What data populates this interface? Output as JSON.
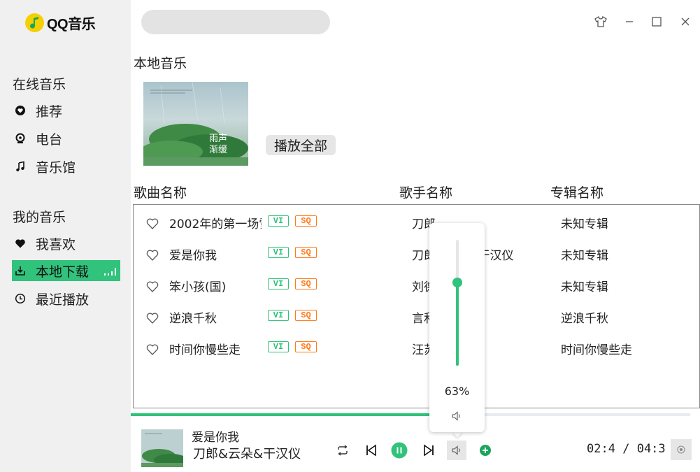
{
  "app": {
    "logo_text": "QQ音乐"
  },
  "sidebar": {
    "online_title": "在线音乐",
    "online_items": [
      {
        "label": "推荐",
        "icon": "recommend-icon"
      },
      {
        "label": "电台",
        "icon": "radio-icon"
      },
      {
        "label": "音乐馆",
        "icon": "music-note-icon"
      }
    ],
    "mine_title": "我的音乐",
    "mine_items": [
      {
        "label": "我喜欢",
        "icon": "heart-icon"
      },
      {
        "label": "本地下载",
        "icon": "download-icon",
        "active": true
      },
      {
        "label": "最近播放",
        "icon": "clock-icon"
      }
    ]
  },
  "search": {
    "placeholder": ""
  },
  "page": {
    "title": "本地音乐",
    "cover_text_line1": "雨声",
    "cover_text_line2": "渐缓",
    "play_all_label": "播放全部"
  },
  "table": {
    "headers": [
      "歌曲名称",
      "歌手名称",
      "专辑名称"
    ],
    "tag_vip": "VI",
    "tag_sq": "SQ",
    "rows": [
      {
        "song": "2002年的第一场雪",
        "artist": "刀郎",
        "album": "未知专辑"
      },
      {
        "song": "爱是你我",
        "artist": "刀郎&云朵&干汉仪",
        "album": "未知专辑"
      },
      {
        "song": "笨小孩(国)",
        "artist": "刘德华",
        "album": "未知专辑"
      },
      {
        "song": "逆浪千秋",
        "artist": "言和",
        "album": "逆浪千秋"
      },
      {
        "song": "时间你慢些走",
        "artist": "汪苏泷",
        "album": "时间你慢些走"
      }
    ]
  },
  "volume": {
    "percent_label": "63%",
    "level": 0.63
  },
  "player": {
    "progress": 0.535,
    "title": "爱是你我",
    "artist": "刀郎&云朵&干汉仪",
    "current_time": "02:4",
    "separator": "/",
    "total_time": "04:3"
  },
  "colors": {
    "accent": "#31c27c",
    "sq_tag": "#ff7a1a",
    "sidebar_bg": "#f0f0f0"
  }
}
